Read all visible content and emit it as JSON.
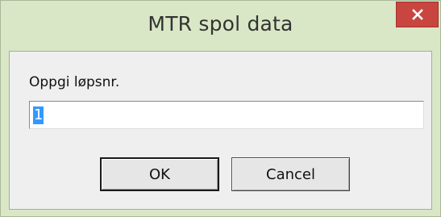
{
  "window": {
    "title": "MTR spol data",
    "close_icon": "close-icon"
  },
  "dialog": {
    "prompt_label": "Oppgi løpsnr.",
    "input_value": "1",
    "ok_label": "OK",
    "cancel_label": "Cancel"
  },
  "colors": {
    "titlebar": "#d9e7c6",
    "close_button": "#c9453f",
    "client_background": "#efefef",
    "selection": "#3399ff"
  }
}
